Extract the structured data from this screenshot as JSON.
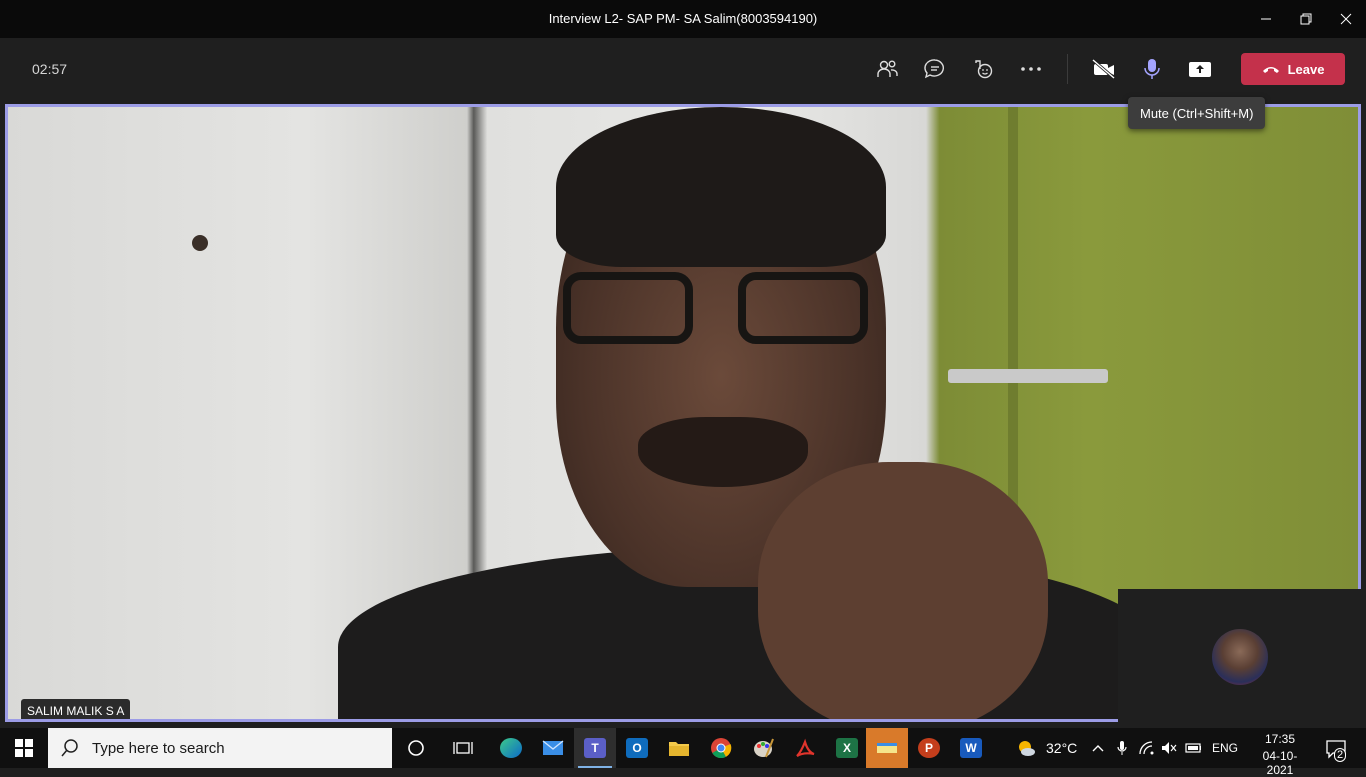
{
  "window": {
    "title": "Interview L2- SAP PM- SA Salim(8003594190)"
  },
  "toolbar": {
    "timer": "02:57",
    "leave_label": "Leave",
    "mic_tooltip": "Mute (Ctrl+Shift+M)",
    "icons": [
      "participants-icon",
      "chat-icon",
      "reactions-icon",
      "more-icon",
      "camera-off-icon",
      "microphone-icon",
      "share-icon"
    ]
  },
  "stage": {
    "participant_name": "SALIM MALIK S A",
    "frame_color": "#9c9ce6"
  },
  "taskbar": {
    "search_placeholder": "Type here to search",
    "pinned_apps": [
      "cortana",
      "task-view",
      "edge",
      "mail",
      "teams",
      "outlook",
      "file-explorer",
      "chrome",
      "paint",
      "acrobat",
      "excel",
      "sticky-notes",
      "powerpoint",
      "word"
    ],
    "weather_temp": "32°C",
    "language": "ENG",
    "time": "17:35",
    "date": "04-10-2021",
    "notification_count": "2"
  },
  "colors": {
    "leave_red": "#c4314b",
    "accent_purple": "#9c9ce6",
    "mic_active": "#a4a4ff"
  }
}
